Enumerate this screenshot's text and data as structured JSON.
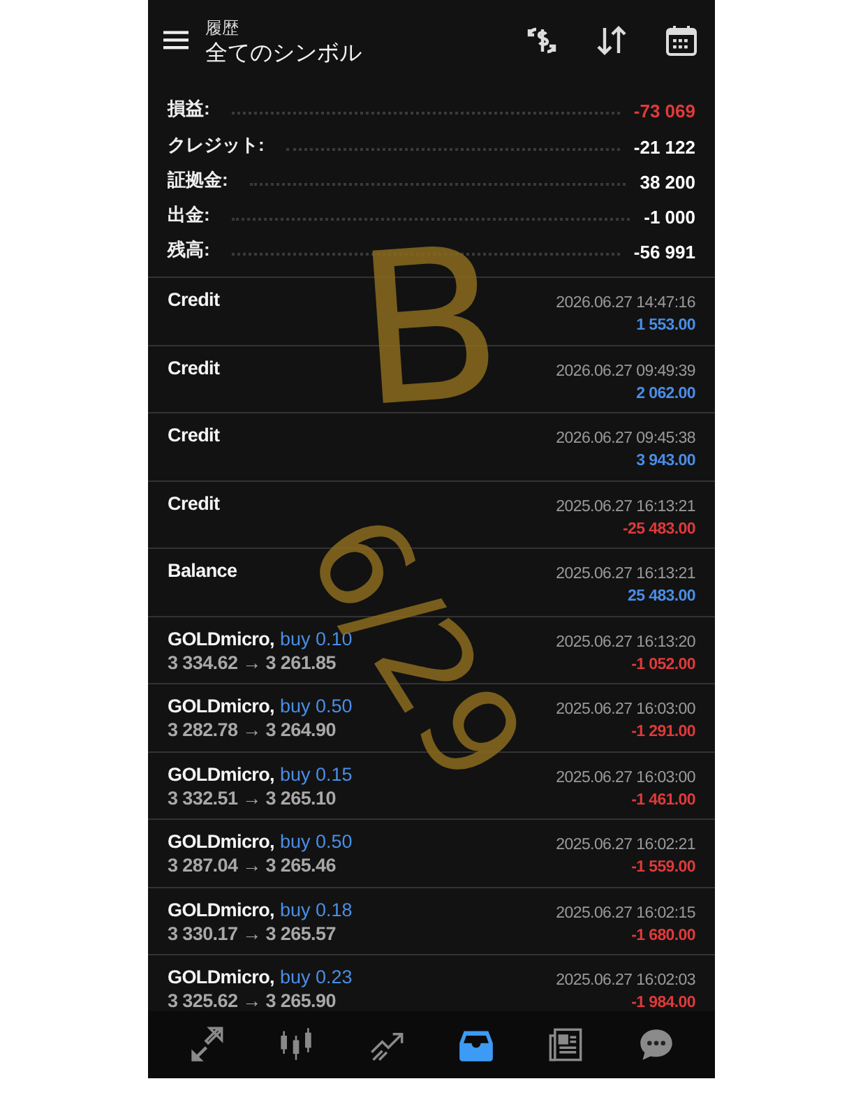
{
  "header": {
    "subtitle": "履歴",
    "title": "全てのシンボル"
  },
  "summary": [
    {
      "label": "損益:",
      "value": "-73 069",
      "color": "#e03a3a"
    },
    {
      "label": "クレジット:",
      "value": "-21 122",
      "color": "#ffffff"
    },
    {
      "label": "証拠金:",
      "value": "38 200",
      "color": "#ffffff"
    },
    {
      "label": "出金:",
      "value": "-1 000",
      "color": "#ffffff"
    },
    {
      "label": "残高:",
      "value": "-56 991",
      "color": "#ffffff"
    }
  ],
  "deals": [
    {
      "kind": "operation",
      "name": "Credit",
      "time": "2026.06.27 14:47:16",
      "amount": "1 553.00",
      "color": "#4a8ee6"
    },
    {
      "kind": "operation",
      "name": "Credit",
      "time": "2026.06.27 09:49:39",
      "amount": "2 062.00",
      "color": "#4a8ee6"
    },
    {
      "kind": "operation",
      "name": "Credit",
      "time": "2026.06.27 09:45:38",
      "amount": "3 943.00",
      "color": "#4a8ee6"
    },
    {
      "kind": "operation",
      "name": "Credit",
      "time": "2025.06.27 16:13:21",
      "amount": "-25 483.00",
      "color": "#e03a3a"
    },
    {
      "kind": "operation",
      "name": "Balance",
      "time": "2025.06.27 16:13:21",
      "amount": "25 483.00",
      "color": "#4a8ee6"
    },
    {
      "kind": "trade",
      "name": "GOLDmicro,",
      "side": "buy 0.10",
      "prices": "3 334.62 → 3 261.85",
      "time": "2025.06.27 16:13:20",
      "amount": "-1 052.00",
      "color": "#e03a3a"
    },
    {
      "kind": "trade",
      "name": "GOLDmicro,",
      "side": "buy 0.50",
      "prices": "3 282.78 → 3 264.90",
      "time": "2025.06.27 16:03:00",
      "amount": "-1 291.00",
      "color": "#e03a3a"
    },
    {
      "kind": "trade",
      "name": "GOLDmicro,",
      "side": "buy 0.15",
      "prices": "3 332.51 → 3 265.10",
      "time": "2025.06.27 16:03:00",
      "amount": "-1 461.00",
      "color": "#e03a3a"
    },
    {
      "kind": "trade",
      "name": "GOLDmicro,",
      "side": "buy 0.50",
      "prices": "3 287.04 → 3 265.46",
      "time": "2025.06.27 16:02:21",
      "amount": "-1 559.00",
      "color": "#e03a3a"
    },
    {
      "kind": "trade",
      "name": "GOLDmicro,",
      "side": "buy 0.18",
      "prices": "3 330.17 → 3 265.57",
      "time": "2025.06.27 16:02:15",
      "amount": "-1 680.00",
      "color": "#e03a3a"
    },
    {
      "kind": "trade",
      "name": "GOLDmicro,",
      "side": "buy 0.23",
      "prices": "3 325.62 → 3 265.90",
      "time": "2025.06.27 16:02:03",
      "amount": "-1 984.00",
      "color": "#e03a3a"
    }
  ],
  "nav": [
    {
      "kind": "quotes",
      "selected": false
    },
    {
      "kind": "chart",
      "selected": false
    },
    {
      "kind": "trade",
      "selected": false
    },
    {
      "kind": "history",
      "selected": true
    },
    {
      "kind": "news",
      "selected": false
    },
    {
      "kind": "chat",
      "selected": false
    }
  ],
  "annotation": [
    "B",
    "6/29"
  ]
}
